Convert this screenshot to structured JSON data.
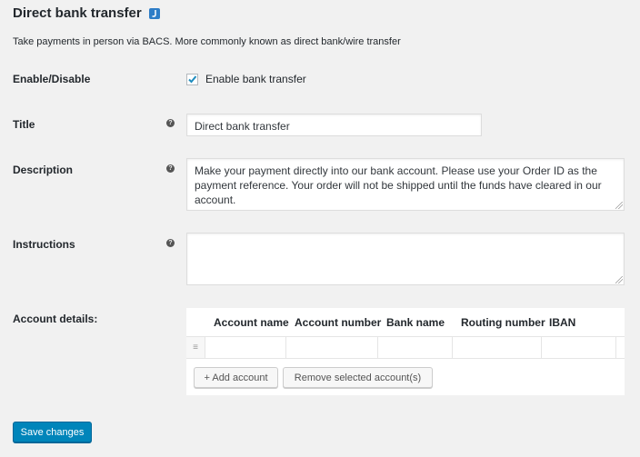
{
  "header": {
    "title": "Direct bank transfer",
    "badge_icon": "return-arrow-icon",
    "badge_glyph": "⤴",
    "description": "Take payments in person via BACS. More commonly known as direct bank/wire transfer"
  },
  "fields": {
    "enable": {
      "label": "Enable/Disable",
      "checkbox_label": "Enable bank transfer",
      "checked": true
    },
    "title": {
      "label": "Title",
      "value": "Direct bank transfer"
    },
    "description": {
      "label": "Description",
      "value": "Make your payment directly into our bank account. Please use your Order ID as the payment reference. Your order will not be shipped until the funds have cleared in our account."
    },
    "instructions": {
      "label": "Instructions",
      "value": ""
    },
    "account_details": {
      "label": "Account details:",
      "columns": [
        "Account name",
        "Account number",
        "Bank name",
        "Routing number",
        "IBAN"
      ],
      "rows": [
        {
          "account_name": "",
          "account_number": "",
          "bank_name": "",
          "routing_number": "",
          "iban": ""
        }
      ],
      "add_button": "+ Add account",
      "remove_button": "Remove selected account(s)"
    }
  },
  "help_glyph": "?",
  "footer": {
    "save_button": "Save changes"
  },
  "colors": {
    "primary": "#0085ba",
    "badge": "#2e7dc7",
    "background": "#f1f1f1"
  }
}
